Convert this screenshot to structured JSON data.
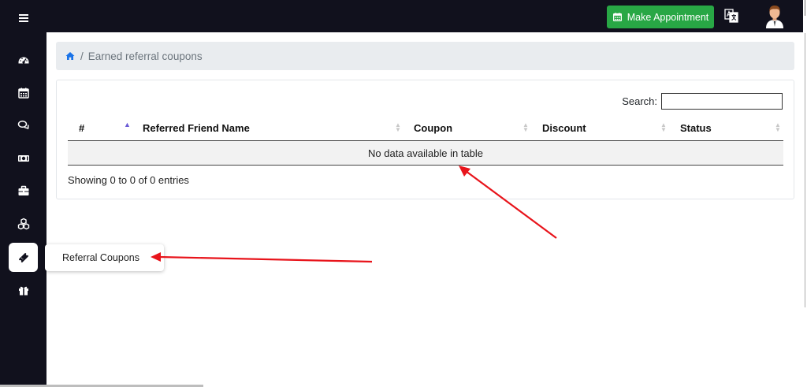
{
  "topbar": {
    "make_appointment_label": "Make Appointment"
  },
  "breadcrumb": {
    "separator": "/",
    "current": "Earned referral coupons"
  },
  "table": {
    "search_label": "Search:",
    "search_value": "",
    "columns": [
      "#",
      "Referred Friend Name",
      "Coupon",
      "Discount",
      "Status"
    ],
    "empty_message": "No data available in table",
    "info": "Showing 0 to 0 of 0 entries"
  },
  "sidebar": {
    "items": [
      {
        "icon": "dashboard-icon"
      },
      {
        "icon": "calendar-icon"
      },
      {
        "icon": "chat-icon"
      },
      {
        "icon": "money-icon"
      },
      {
        "icon": "briefcase-icon"
      },
      {
        "icon": "cubes-icon"
      },
      {
        "icon": "ticket-icon",
        "active": true
      },
      {
        "icon": "gift-icon"
      }
    ],
    "tooltip": "Referral Coupons"
  },
  "colors": {
    "sidebar_bg": "#11111d",
    "accent_green": "#28a745",
    "annotation_red": "#e8141b",
    "link_blue": "#1a73e8"
  }
}
